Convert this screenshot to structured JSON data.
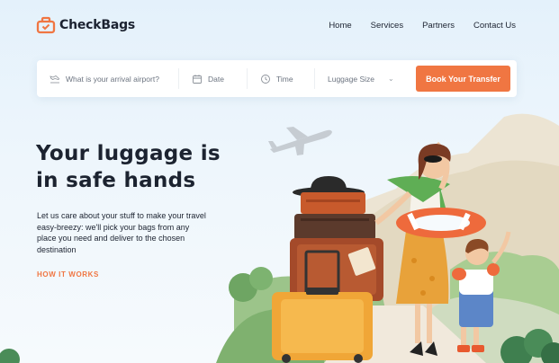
{
  "brand": {
    "name": "CheckBags",
    "accent": "#f07642"
  },
  "nav": {
    "items": [
      "Home",
      "Services",
      "Partners",
      "Contact Us"
    ]
  },
  "search": {
    "airport_placeholder": "What is your arrival airport?",
    "date_placeholder": "Date",
    "time_placeholder": "Time",
    "size_placeholder": "Luggage Size",
    "book_label": "Book Your Transfer",
    "icons": [
      "plane-arrival-icon",
      "calendar-icon",
      "clock-icon",
      "chevron-down-icon"
    ]
  },
  "hero": {
    "title_line1": "Your luggage is",
    "title_line2": "in safe hands",
    "description": "Let us care about your stuff to make your travel easy-breezy: we'll pick your bags from any place you need and deliver to the chosen destination",
    "link_label": "HOW IT WORKS"
  }
}
